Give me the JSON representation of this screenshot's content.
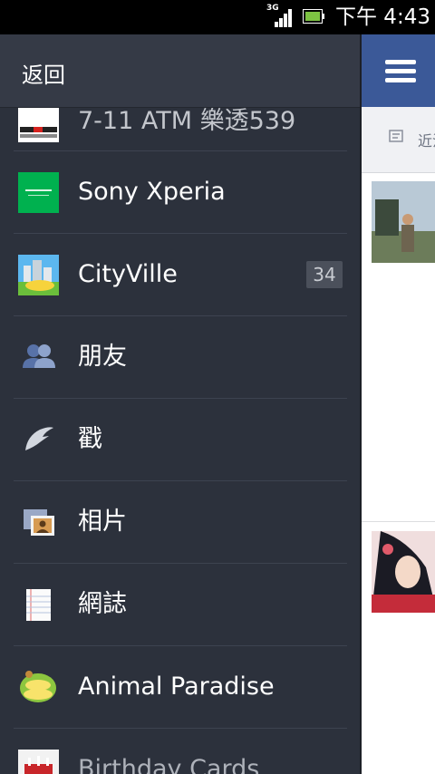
{
  "status_bar": {
    "network": "3G",
    "time": "下午 4:43"
  },
  "drawer": {
    "back_label": "返回",
    "items": [
      {
        "label": "7-11 ATM 樂透539",
        "icon": "711-atm-app-icon"
      },
      {
        "label": "Sony Xperia",
        "icon": "sony-xperia-app-icon"
      },
      {
        "label": "CityVille",
        "icon": "cityville-app-icon",
        "badge": "34"
      },
      {
        "label": "朋友",
        "icon": "friends-icon"
      },
      {
        "label": "戳",
        "icon": "poke-icon"
      },
      {
        "label": "相片",
        "icon": "photos-icon"
      },
      {
        "label": "網誌",
        "icon": "notes-icon"
      },
      {
        "label": "Animal Paradise",
        "icon": "animal-paradise-app-icon"
      },
      {
        "label": "Birthday Cards",
        "icon": "birthday-cards-app-icon"
      }
    ]
  },
  "feed": {
    "subbar_text": "近況"
  },
  "colors": {
    "facebook_blue": "#3b5998",
    "drawer_bg": "#2c313c",
    "xperia_green": "#00b14f"
  }
}
